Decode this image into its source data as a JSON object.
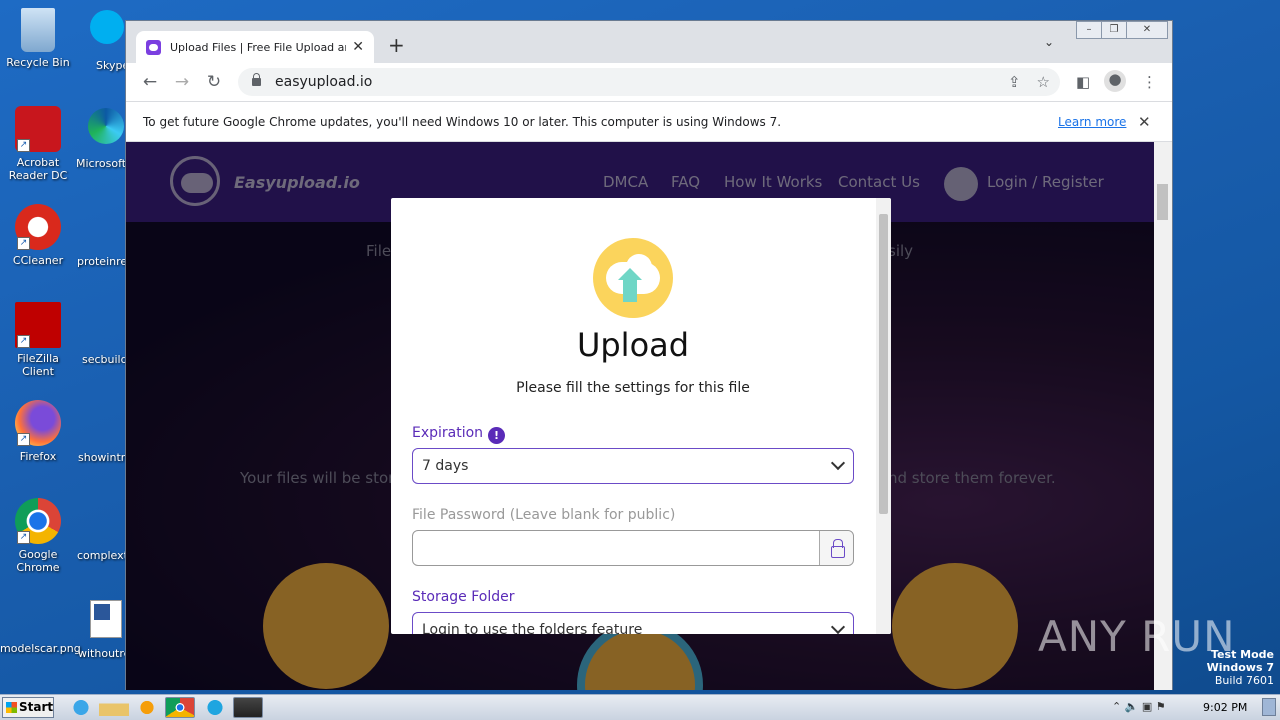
{
  "desktop": {
    "icons": [
      {
        "label": "Recycle Bin"
      },
      {
        "label": "Acrobat Reader DC"
      },
      {
        "label": "CCleaner"
      },
      {
        "label": "FileZilla Client"
      },
      {
        "label": "Firefox"
      },
      {
        "label": "Google Chrome"
      },
      {
        "label": "modelscar.png"
      }
    ],
    "partial_labels": [
      "Skype",
      "Microsoft",
      "proteinrec",
      "secbuild.",
      "showintro",
      "complextr",
      "withoutre"
    ]
  },
  "browser": {
    "tab_title": "Upload Files | Free File Upload and T",
    "url": "easyupload.io",
    "infobar_text": "To get future Google Chrome updates, you'll need Windows 10 or later. This computer is using Windows 7.",
    "infobar_link": "Learn more"
  },
  "site": {
    "logo_text": "Easyupload.io",
    "nav": [
      "DMCA",
      "FAQ",
      "How It Works",
      "Contact Us",
      "Login / Register"
    ],
    "bg_text_left_1": "File",
    "bg_text_right_1": "sily",
    "bg_text_left_2": "Your files will be store",
    "bg_text_right_2": "nd store them forever."
  },
  "modal": {
    "title": "Upload",
    "subtitle": "Please fill the settings for this file",
    "expiration_label": "Expiration",
    "expiration_value": "7 days",
    "password_label": "File Password (Leave blank for public)",
    "password_value": "",
    "storage_label": "Storage Folder",
    "storage_value": "Login to use the folders feature"
  },
  "taskbar": {
    "start_label": "Start",
    "clock": "9:02 PM"
  },
  "watermark": "ANY RUN",
  "test_mode": [
    "Test Mode",
    "Windows 7",
    "Build 7601"
  ]
}
